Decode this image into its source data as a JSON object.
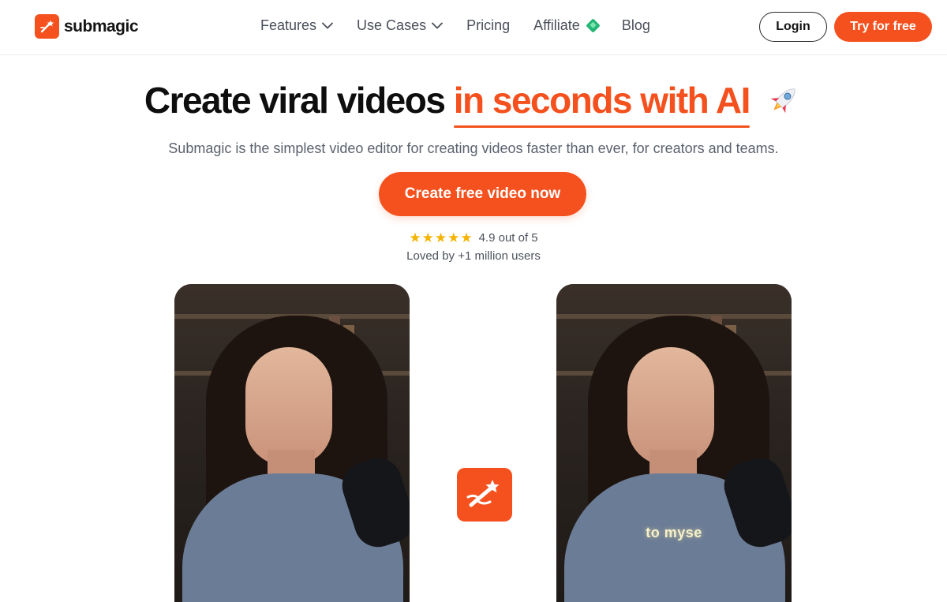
{
  "brand": {
    "name": "submagic",
    "accent": "#f4511e"
  },
  "nav": {
    "items": [
      {
        "label": "Features",
        "has_dropdown": true
      },
      {
        "label": "Use Cases",
        "has_dropdown": true
      },
      {
        "label": "Pricing",
        "has_dropdown": false
      },
      {
        "label": "Affiliate",
        "has_dropdown": false,
        "icon": "gem-icon"
      },
      {
        "label": "Blog",
        "has_dropdown": false
      }
    ],
    "login_label": "Login",
    "try_label": "Try for free"
  },
  "hero": {
    "title_main": "Create viral videos",
    "title_accent": "in seconds with AI",
    "title_icon": "rocket-icon",
    "subtitle": "Submagic is the simplest video editor for creating videos faster than ever, for creators and teams.",
    "cta_label": "Create free video now",
    "rating": {
      "stars": 5,
      "text": "4.9 out of 5"
    },
    "loved_text": "Loved by +1 million users"
  },
  "videos": {
    "before_caption": "",
    "after_caption": "to myse"
  }
}
